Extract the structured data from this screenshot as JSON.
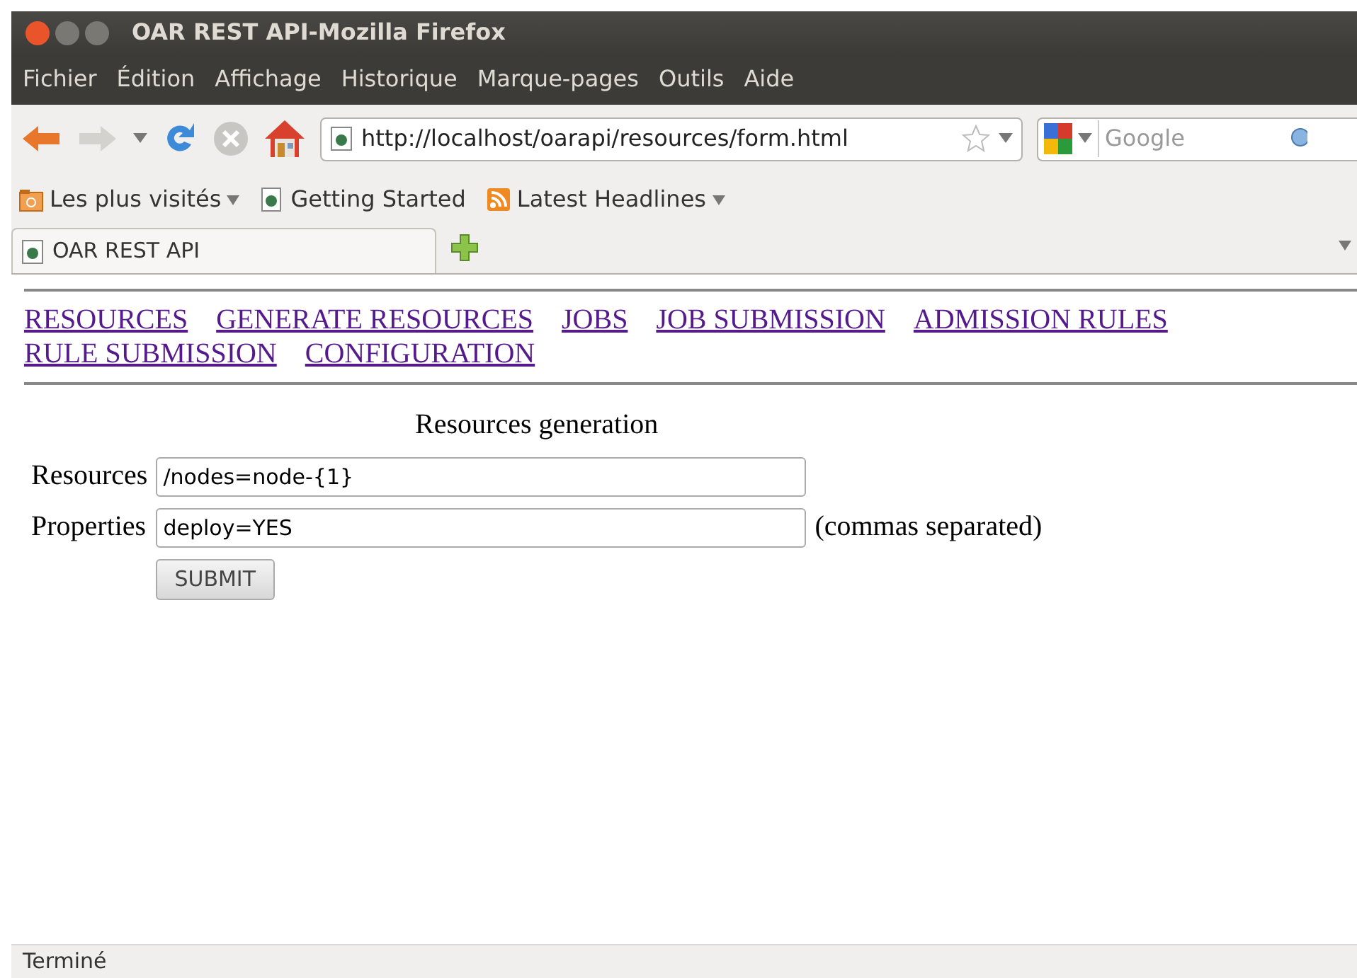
{
  "window": {
    "title": "OAR REST API-Mozilla Firefox"
  },
  "menu": [
    "Fichier",
    "Édition",
    "Affichage",
    "Historique",
    "Marque-pages",
    "Outils",
    "Aide"
  ],
  "address_bar": {
    "url": "http://localhost/oarapi/resources/form.html"
  },
  "search": {
    "placeholder": "Google"
  },
  "bookmarks": [
    {
      "label": "Les plus visités",
      "kind": "folder"
    },
    {
      "label": "Getting Started",
      "kind": "page"
    },
    {
      "label": "Latest Headlines",
      "kind": "feed"
    }
  ],
  "tabs": [
    {
      "label": "OAR REST API",
      "selected": true
    }
  ],
  "page": {
    "nav_links": [
      [
        "RESOURCES",
        "GENERATE RESOURCES",
        "JOBS",
        "JOB SUBMISSION",
        "ADMISSION RULES"
      ],
      [
        "RULE SUBMISSION",
        "CONFIGURATION"
      ]
    ],
    "form_title": "Resources generation",
    "fields": [
      {
        "label": "Resources",
        "value": "/nodes=node-{1}"
      },
      {
        "label": "Properties",
        "value": "deploy=YES",
        "hint": "(commas separated)"
      }
    ],
    "submit": "SUBMIT"
  },
  "status_bar": "Terminé"
}
